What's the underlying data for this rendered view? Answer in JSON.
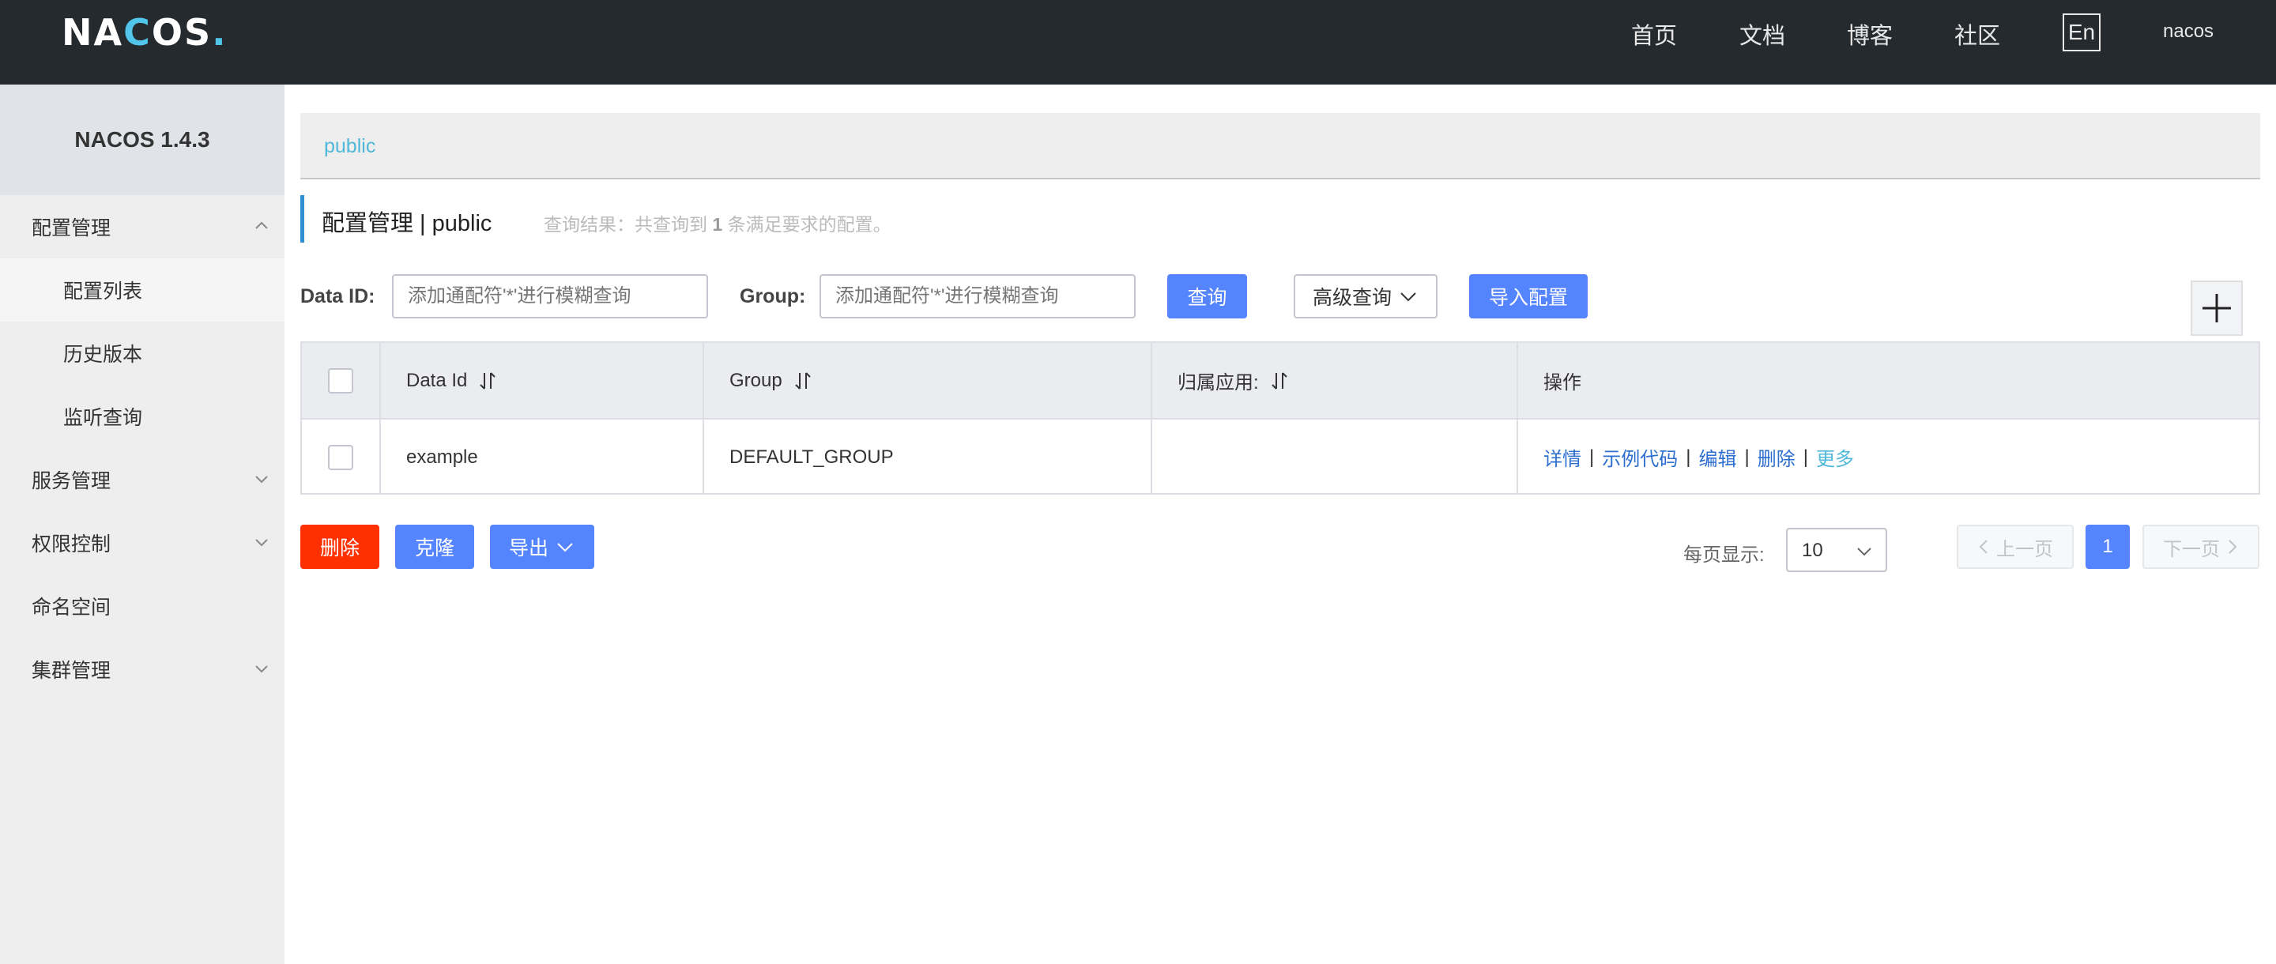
{
  "header": {
    "logo_parts": [
      "NA",
      "C",
      "OS",
      "."
    ],
    "nav": [
      "首页",
      "文档",
      "博客",
      "社区"
    ],
    "lang": "En",
    "user": "nacos"
  },
  "sidebar": {
    "title": "NACOS 1.4.3",
    "items": [
      {
        "label": "配置管理",
        "level": 1,
        "expanded": true
      },
      {
        "label": "配置列表",
        "level": 2,
        "active": true
      },
      {
        "label": "历史版本",
        "level": 2
      },
      {
        "label": "监听查询",
        "level": 2
      },
      {
        "label": "服务管理",
        "level": 1,
        "expanded": false
      },
      {
        "label": "权限控制",
        "level": 1,
        "expanded": false
      },
      {
        "label": "命名空间",
        "level": 1
      },
      {
        "label": "集群管理",
        "level": 1,
        "expanded": false
      }
    ]
  },
  "main": {
    "namespace_tab": "public",
    "title": "配置管理 | public",
    "query_hint_prefix": "查询结果：共查询到",
    "query_hint_count": "1",
    "query_hint_suffix": "条满足要求的配置。",
    "filters": {
      "data_id_label": "Data ID:",
      "data_id_placeholder": "添加通配符'*'进行模糊查询",
      "group_label": "Group:",
      "group_placeholder": "添加通配符'*'进行模糊查询",
      "search_button": "查询",
      "advanced_button": "高级查询",
      "import_button": "导入配置"
    },
    "table": {
      "columns": [
        "Data Id",
        "Group",
        "归属应用:",
        "操作"
      ],
      "rows": [
        {
          "data_id": "example",
          "group": "DEFAULT_GROUP",
          "app": "",
          "actions": [
            "详情",
            "示例代码",
            "编辑",
            "删除"
          ],
          "more": "更多"
        }
      ]
    },
    "bulk": {
      "delete": "删除",
      "clone": "克隆",
      "export": "导出"
    },
    "pagination": {
      "page_size_label": "每页显示:",
      "page_size": "10",
      "prev": "上一页",
      "current": "1",
      "next": "下一页"
    }
  },
  "colors": {
    "header_bg": "#252a2f",
    "primary": "#5584ff",
    "danger": "#ff3000",
    "link": "#2d6fd0",
    "accent": "#4fb8d8"
  }
}
